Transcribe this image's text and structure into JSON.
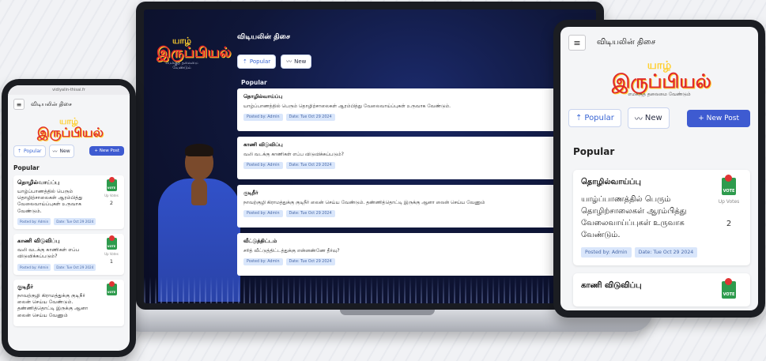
{
  "site": {
    "title": "விடியலின் திசை",
    "logo_mark": "யாழ்",
    "logo_main": "இருப்பியல்",
    "logo_sub": "எமக்குத் தலைமை வேண்டும்",
    "url": "vidiyalin-thisai.fr"
  },
  "tabs": {
    "popular": "Popular",
    "new": "New"
  },
  "new_post_label": "+ New Post",
  "section_heading": "Popular",
  "up_votes_label": "Up Votes",
  "vote_badge": "VOTE",
  "posts": [
    {
      "title": "தொழில்வாய்ப்பு",
      "body": "யாழ்ப்பாணத்தில் பெரும் தொழிற்சாலைகள் ஆரம்பித்து வேலைவாய்ப்புகள் உருவாக வேண்டும்.",
      "posted_by": "Posted by: Admin",
      "date": "Date: Tue Oct 29 2024",
      "votes": "2"
    },
    {
      "title": "காணி விடுவிப்பு",
      "body": "வலி வடக்கு காணிகள் எப்ப விடுவிக்கப்படும்?",
      "posted_by": "Posted by: Admin",
      "date": "Date: Tue Oct 29 2024",
      "votes": "1"
    },
    {
      "title": "குடிநீர்",
      "body": "நாவற்குழி கிராமத்துக்கு குடிநீர் லைன் செய்ய வேண்டும். தண்ணித்தொட்டி இருக்கு ஆனா லைன் செய்ய வேணும்",
      "posted_by": "Posted by: Admin",
      "date": "Date: Tue Oct 29 2024"
    },
    {
      "title": "வீட்டுத்திட்டம்",
      "body": "சரித் வீட்டுத்திட்டத்துக்கு என்னண்ணே தீர்வு?",
      "posted_by": "Posted by: Admin",
      "date": "Date: Tue Oct 29 2024"
    }
  ],
  "colors": {
    "accent": "#3e5bd1",
    "chip_bg": "#d9e6fb",
    "vote_green": "#2e9b4d",
    "laptop_bg": "#0f1638"
  },
  "icons": {
    "menu": "menu-icon",
    "popular": "trending-icon",
    "new": "sparkline-icon",
    "vote": "vote-box-icon"
  }
}
